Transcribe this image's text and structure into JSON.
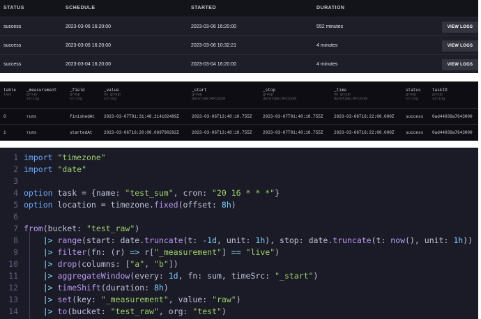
{
  "runs": {
    "headers": {
      "status": "STATUS",
      "schedule": "SCHEDULE",
      "started": "STARTED",
      "duration": "DURATION"
    },
    "rows": [
      {
        "status": "success",
        "schedule": "2023-03-06 16:20:00",
        "started": "2023-03-06 16:20:00",
        "duration": "552 minutes",
        "button": "VIEW LOGS"
      },
      {
        "status": "success",
        "schedule": "2023-03-05 16:20:00",
        "started": "2023-03-06 10:32:21",
        "duration": "4 minutes",
        "button": "VIEW LOGS"
      },
      {
        "status": "success",
        "schedule": "2023-03-04 16:20:00",
        "started": "2023-03-04 16:20:00",
        "duration": "4 minutes",
        "button": "VIEW LOGS"
      }
    ]
  },
  "raw": {
    "columns": [
      {
        "name": "table",
        "sub1": "last",
        "sub2": ""
      },
      {
        "name": "_measurement",
        "sub1": "group",
        "sub2": "string"
      },
      {
        "name": "_field",
        "sub1": "group",
        "sub2": "string"
      },
      {
        "name": "_value",
        "sub1": "no group",
        "sub2": "string"
      },
      {
        "name": "_start",
        "sub1": "group",
        "sub2": "dateTime:RFC3339"
      },
      {
        "name": "_stop",
        "sub1": "group",
        "sub2": "dateTime:RFC3339"
      },
      {
        "name": "_time",
        "sub1": "no group",
        "sub2": "dateTime:RFC3339"
      },
      {
        "name": "status",
        "sub1": "group",
        "sub2": "string"
      },
      {
        "name": "taskID",
        "sub1": "group",
        "sub2": "string"
      }
    ],
    "rows": [
      [
        "0",
        "runs",
        "finishedAt",
        "2023-03-07T01:31:48.214102489Z",
        "2023-03-06T13:48:10.755Z",
        "2023-03-07T01:48:10.755Z",
        "2023-03-06T16:22:00.000Z",
        "success",
        "0ad44039a7643000"
      ],
      [
        "1",
        "runs",
        "startedAt",
        "2023-03-06T16:20:00.069790292Z",
        "2023-03-06T13:48:10.755Z",
        "2023-03-07T01:48:10.755Z",
        "2023-03-06T16:22:00.000Z",
        "success",
        "0ad44039a7643000"
      ]
    ]
  },
  "code": {
    "line_numbers": [
      "1",
      "2",
      "3",
      "4",
      "5",
      "6",
      "7",
      "8",
      "9",
      "10",
      "11",
      "12",
      "13",
      "14"
    ],
    "lines": {
      "l1_kw": "import",
      "l1_str": "\"timezone\"",
      "l2_kw": "import",
      "l2_str": "\"date\"",
      "l4_kw": "option",
      "l4_a": " task = {name: ",
      "l4_s1": "\"test_sum\"",
      "l4_b": ", cron: ",
      "l4_s2": "\"20 16 * * *\"",
      "l4_c": "}",
      "l5_kw": "option",
      "l5_a": " location = timezone.",
      "l5_fn": "fixed",
      "l5_b": "(offset: ",
      "l5_num": "8h",
      "l5_c": ")",
      "l7_fn": "from",
      "l7_a": "(bucket: ",
      "l7_s": "\"test_raw\"",
      "l7_b": ")",
      "l8_pipe": "|>",
      "l8_fn": "range",
      "l8_a": "(start: date.",
      "l8_fn2": "truncate",
      "l8_b": "(t: ",
      "l8_n1": "-1d",
      "l8_c": ", unit: ",
      "l8_n2": "1h",
      "l8_d": "), stop: date.",
      "l8_fn3": "truncate",
      "l8_e": "(t: ",
      "l8_fn4": "now",
      "l8_f": "(), unit: ",
      "l8_n3": "1h",
      "l8_g": "))",
      "l9_pipe": "|>",
      "l9_fn": "filter",
      "l9_a": "(fn: (r) ",
      "l9_arrow": "=>",
      "l9_b": " r[",
      "l9_s1": "\"_measurement\"",
      "l9_c": "] ",
      "l9_eq": "==",
      "l9_d": " ",
      "l9_s2": "\"live\"",
      "l9_e": ")",
      "l10_pipe": "|>",
      "l10_fn": "drop",
      "l10_a": "(columns: [",
      "l10_s1": "\"a\"",
      "l10_b": ", ",
      "l10_s2": "\"b\"",
      "l10_c": "])",
      "l11_pipe": "|>",
      "l11_fn": "aggregateWindow",
      "l11_a": "(every: ",
      "l11_n": "1d",
      "l11_b": ", fn: sum, timeSrc: ",
      "l11_s": "\"_start\"",
      "l11_c": ")",
      "l12_pipe": "|>",
      "l12_fn": "timeShift",
      "l12_a": "(duration: ",
      "l12_n": "8h",
      "l12_b": ")",
      "l13_pipe": "|>",
      "l13_fn": "set",
      "l13_a": "(key: ",
      "l13_s1": "\"_measurement\"",
      "l13_b": ", value: ",
      "l13_s2": "\"raw\"",
      "l13_c": ")",
      "l14_pipe": "|>",
      "l14_fn": "to",
      "l14_a": "(bucket: ",
      "l14_s1": "\"test_raw\"",
      "l14_b": ", org: ",
      "l14_s2": "\"test\"",
      "l14_c": ")"
    }
  }
}
